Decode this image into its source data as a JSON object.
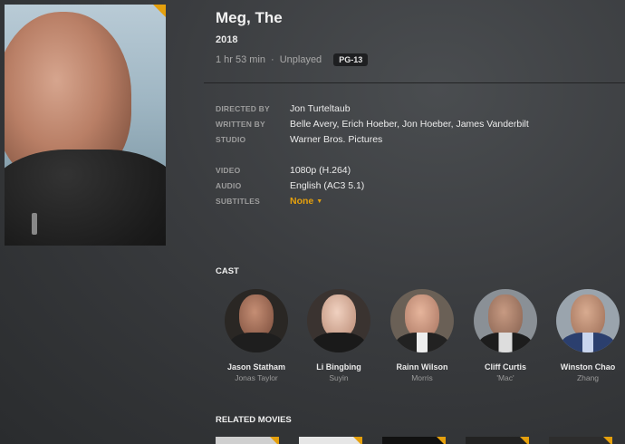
{
  "movie": {
    "title": "Meg, The",
    "year": "2018",
    "duration": "1 hr 53 min",
    "separator": "·",
    "play_status": "Unplayed",
    "content_rating": "PG-13"
  },
  "details": {
    "directed_by_label": "DIRECTED BY",
    "directed_by": "Jon Turteltaub",
    "written_by_label": "WRITTEN BY",
    "written_by": "Belle Avery, Erich Hoeber, Jon Hoeber, James Vanderbilt",
    "studio_label": "STUDIO",
    "studio": "Warner Bros. Pictures",
    "video_label": "VIDEO",
    "video": "1080p (H.264)",
    "audio_label": "AUDIO",
    "audio": "English (AC3 5.1)",
    "subtitles_label": "SUBTITLES",
    "subtitles": "None",
    "dropdown_icon": "caret-down-icon"
  },
  "cast_heading": "CAST",
  "cast": [
    {
      "name": "Jason Statham",
      "role": "Jonas Taylor"
    },
    {
      "name": "Li Bingbing",
      "role": "Suyin"
    },
    {
      "name": "Rainn Wilson",
      "role": "Morris"
    },
    {
      "name": "Cliff Curtis",
      "role": "'Mac'"
    },
    {
      "name": "Winston Chao",
      "role": "Zhang"
    }
  ],
  "related_heading": "RELATED MOVIES",
  "colors": {
    "accent": "#e5a00d",
    "background": "#3a3c3f"
  }
}
